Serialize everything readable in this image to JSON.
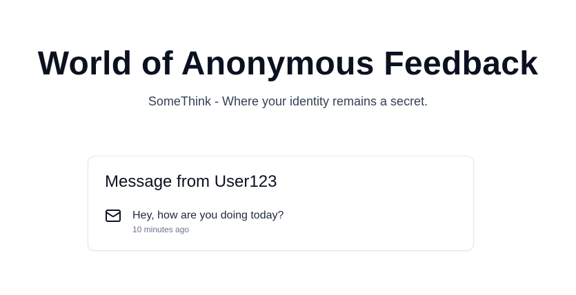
{
  "header": {
    "title": "World of Anonymous Feedback",
    "subtitle": "SomeThink - Where your identity remains a secret."
  },
  "message_card": {
    "title": "Message from User123",
    "icon": "mail-icon",
    "message": "Hey, how are you doing today?",
    "timestamp": "10 minutes ago"
  }
}
